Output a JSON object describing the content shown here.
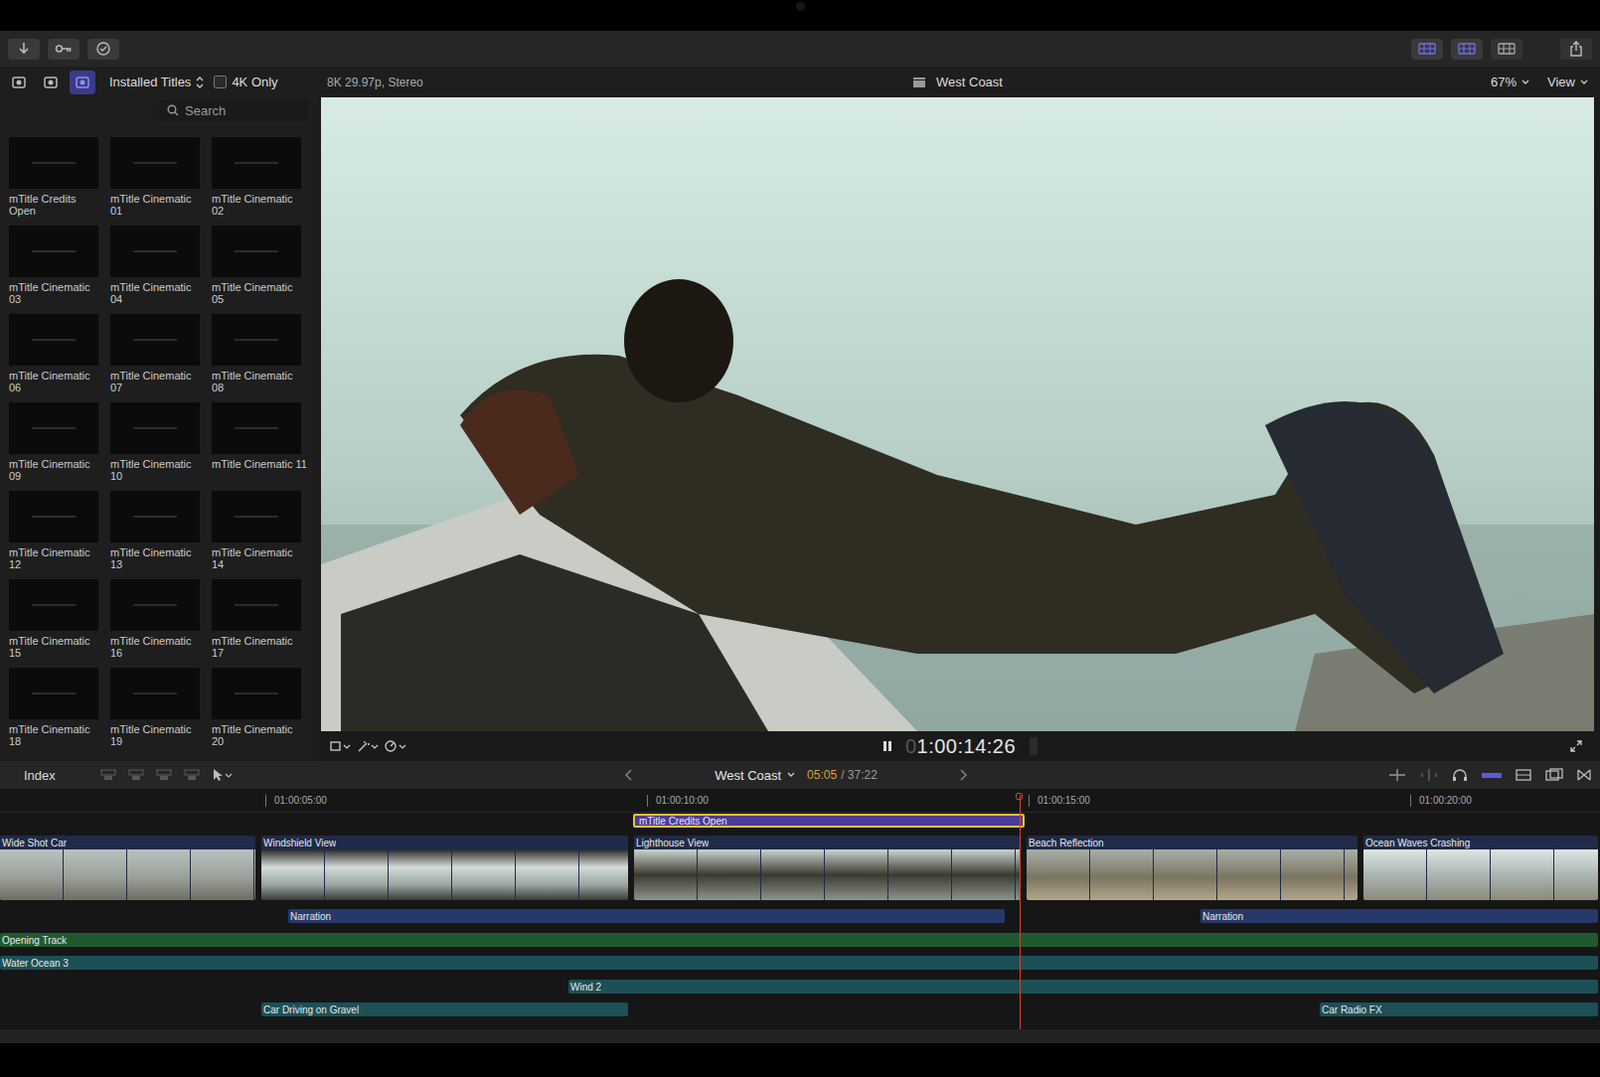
{
  "window": {
    "title": "West Coast"
  },
  "toolbar": {
    "view_toggles": [
      {
        "on": true
      },
      {
        "on": true
      },
      {
        "on": false
      }
    ]
  },
  "browser": {
    "library_tabs": [
      {
        "selected": false
      },
      {
        "selected": false
      },
      {
        "selected": true
      }
    ],
    "dropdown": "Installed Titles",
    "filter": {
      "label": "4K Only",
      "checked": false
    },
    "search": {
      "placeholder": "Search"
    },
    "items": [
      {
        "label": "mTitle Credits Open",
        "selected": false
      },
      {
        "label": "mTitle Cinematic 01",
        "selected": false
      },
      {
        "label": "mTitle Cinematic 02",
        "selected": false
      },
      {
        "label": "mTitle Cinematic 03",
        "selected": false
      },
      {
        "label": "mTitle Cinematic 04",
        "selected": false
      },
      {
        "label": "mTitle Cinematic 05",
        "selected": false
      },
      {
        "label": "mTitle Cinematic 06",
        "selected": false
      },
      {
        "label": "mTitle Cinematic 07",
        "selected": false
      },
      {
        "label": "mTitle Cinematic 08",
        "selected": false
      },
      {
        "label": "mTitle Cinematic 09",
        "selected": false
      },
      {
        "label": "mTitle Cinematic 10",
        "selected": false
      },
      {
        "label": "mTitle Cinematic 11",
        "selected": false
      },
      {
        "label": "mTitle Cinematic 12",
        "selected": false
      },
      {
        "label": "mTitle Cinematic 13",
        "selected": false
      },
      {
        "label": "mTitle Cinematic 14",
        "selected": false
      },
      {
        "label": "mTitle Cinematic 15",
        "selected": false
      },
      {
        "label": "mTitle Cinematic 16",
        "selected": false
      },
      {
        "label": "mTitle Cinematic 17",
        "selected": false
      },
      {
        "label": "mTitle Cinematic 18",
        "selected": false
      },
      {
        "label": "mTitle Cinematic 19",
        "selected": false
      },
      {
        "label": "mTitle Cinematic 20",
        "selected": false
      }
    ]
  },
  "viewer": {
    "format": "8K 29.97p, Stereo",
    "title": "West Coast",
    "zoom": "67%",
    "view": "View",
    "playing": true,
    "timecode_dim": "0",
    "timecode": "1:00:14:26"
  },
  "timeline": {
    "index": "Index",
    "project": "West Coast",
    "position": "05:05",
    "separator": "/",
    "duration": "37:22",
    "ruler": [
      "01:00:05:00",
      "01:00:10:00",
      "01:00:15:00",
      "01:00:20:00"
    ],
    "title_clips": [
      {
        "name": "mTitle Credits Open",
        "selected": true
      }
    ],
    "video_clips": [
      {
        "name": "Wide Shot Car"
      },
      {
        "name": "Windshield View"
      },
      {
        "name": "Lighthouse View"
      },
      {
        "name": "Beach Reflection"
      },
      {
        "name": "Ocean Waves Crashing"
      }
    ],
    "audio_clips": [
      {
        "name": "Narration",
        "color": "#27386a"
      },
      {
        "name": "Narration",
        "color": "#27386a"
      },
      {
        "name": "Opening Track",
        "color": "#1f5a2e"
      },
      {
        "name": "Water Ocean 3",
        "color": "#1c5057"
      },
      {
        "name": "Wind 2",
        "color": "#1c5057"
      },
      {
        "name": "Car Driving on Gravel",
        "color": "#1c5057"
      },
      {
        "name": "Car Radio FX",
        "color": "#1c5057"
      }
    ]
  }
}
